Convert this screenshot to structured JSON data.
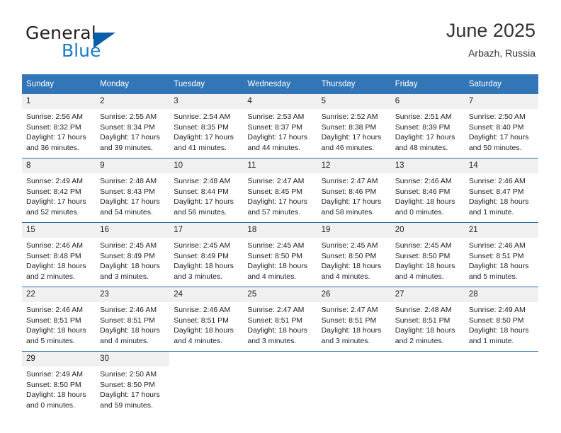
{
  "brand": {
    "name_part1": "General",
    "name_part2": "Blue",
    "accent_color": "#1a7bc4",
    "triangle_color": "#0b5ea8"
  },
  "header": {
    "title": "June 2025",
    "location": "Arbazh, Russia"
  },
  "calendar": {
    "header_bg": "#3276b8",
    "row_divider_color": "#2e6da4",
    "daynum_bg": "#f0f0f0",
    "weekdays": [
      "Sunday",
      "Monday",
      "Tuesday",
      "Wednesday",
      "Thursday",
      "Friday",
      "Saturday"
    ],
    "weeks": [
      [
        {
          "day": "1",
          "sunrise": "Sunrise: 2:56 AM",
          "sunset": "Sunset: 8:32 PM",
          "daylight1": "Daylight: 17 hours",
          "daylight2": "and 36 minutes."
        },
        {
          "day": "2",
          "sunrise": "Sunrise: 2:55 AM",
          "sunset": "Sunset: 8:34 PM",
          "daylight1": "Daylight: 17 hours",
          "daylight2": "and 39 minutes."
        },
        {
          "day": "3",
          "sunrise": "Sunrise: 2:54 AM",
          "sunset": "Sunset: 8:35 PM",
          "daylight1": "Daylight: 17 hours",
          "daylight2": "and 41 minutes."
        },
        {
          "day": "4",
          "sunrise": "Sunrise: 2:53 AM",
          "sunset": "Sunset: 8:37 PM",
          "daylight1": "Daylight: 17 hours",
          "daylight2": "and 44 minutes."
        },
        {
          "day": "5",
          "sunrise": "Sunrise: 2:52 AM",
          "sunset": "Sunset: 8:38 PM",
          "daylight1": "Daylight: 17 hours",
          "daylight2": "and 46 minutes."
        },
        {
          "day": "6",
          "sunrise": "Sunrise: 2:51 AM",
          "sunset": "Sunset: 8:39 PM",
          "daylight1": "Daylight: 17 hours",
          "daylight2": "and 48 minutes."
        },
        {
          "day": "7",
          "sunrise": "Sunrise: 2:50 AM",
          "sunset": "Sunset: 8:40 PM",
          "daylight1": "Daylight: 17 hours",
          "daylight2": "and 50 minutes."
        }
      ],
      [
        {
          "day": "8",
          "sunrise": "Sunrise: 2:49 AM",
          "sunset": "Sunset: 8:42 PM",
          "daylight1": "Daylight: 17 hours",
          "daylight2": "and 52 minutes."
        },
        {
          "day": "9",
          "sunrise": "Sunrise: 2:48 AM",
          "sunset": "Sunset: 8:43 PM",
          "daylight1": "Daylight: 17 hours",
          "daylight2": "and 54 minutes."
        },
        {
          "day": "10",
          "sunrise": "Sunrise: 2:48 AM",
          "sunset": "Sunset: 8:44 PM",
          "daylight1": "Daylight: 17 hours",
          "daylight2": "and 56 minutes."
        },
        {
          "day": "11",
          "sunrise": "Sunrise: 2:47 AM",
          "sunset": "Sunset: 8:45 PM",
          "daylight1": "Daylight: 17 hours",
          "daylight2": "and 57 minutes."
        },
        {
          "day": "12",
          "sunrise": "Sunrise: 2:47 AM",
          "sunset": "Sunset: 8:46 PM",
          "daylight1": "Daylight: 17 hours",
          "daylight2": "and 58 minutes."
        },
        {
          "day": "13",
          "sunrise": "Sunrise: 2:46 AM",
          "sunset": "Sunset: 8:46 PM",
          "daylight1": "Daylight: 18 hours",
          "daylight2": "and 0 minutes."
        },
        {
          "day": "14",
          "sunrise": "Sunrise: 2:46 AM",
          "sunset": "Sunset: 8:47 PM",
          "daylight1": "Daylight: 18 hours",
          "daylight2": "and 1 minute."
        }
      ],
      [
        {
          "day": "15",
          "sunrise": "Sunrise: 2:46 AM",
          "sunset": "Sunset: 8:48 PM",
          "daylight1": "Daylight: 18 hours",
          "daylight2": "and 2 minutes."
        },
        {
          "day": "16",
          "sunrise": "Sunrise: 2:45 AM",
          "sunset": "Sunset: 8:49 PM",
          "daylight1": "Daylight: 18 hours",
          "daylight2": "and 3 minutes."
        },
        {
          "day": "17",
          "sunrise": "Sunrise: 2:45 AM",
          "sunset": "Sunset: 8:49 PM",
          "daylight1": "Daylight: 18 hours",
          "daylight2": "and 3 minutes."
        },
        {
          "day": "18",
          "sunrise": "Sunrise: 2:45 AM",
          "sunset": "Sunset: 8:50 PM",
          "daylight1": "Daylight: 18 hours",
          "daylight2": "and 4 minutes."
        },
        {
          "day": "19",
          "sunrise": "Sunrise: 2:45 AM",
          "sunset": "Sunset: 8:50 PM",
          "daylight1": "Daylight: 18 hours",
          "daylight2": "and 4 minutes."
        },
        {
          "day": "20",
          "sunrise": "Sunrise: 2:45 AM",
          "sunset": "Sunset: 8:50 PM",
          "daylight1": "Daylight: 18 hours",
          "daylight2": "and 4 minutes."
        },
        {
          "day": "21",
          "sunrise": "Sunrise: 2:46 AM",
          "sunset": "Sunset: 8:51 PM",
          "daylight1": "Daylight: 18 hours",
          "daylight2": "and 5 minutes."
        }
      ],
      [
        {
          "day": "22",
          "sunrise": "Sunrise: 2:46 AM",
          "sunset": "Sunset: 8:51 PM",
          "daylight1": "Daylight: 18 hours",
          "daylight2": "and 5 minutes."
        },
        {
          "day": "23",
          "sunrise": "Sunrise: 2:46 AM",
          "sunset": "Sunset: 8:51 PM",
          "daylight1": "Daylight: 18 hours",
          "daylight2": "and 4 minutes."
        },
        {
          "day": "24",
          "sunrise": "Sunrise: 2:46 AM",
          "sunset": "Sunset: 8:51 PM",
          "daylight1": "Daylight: 18 hours",
          "daylight2": "and 4 minutes."
        },
        {
          "day": "25",
          "sunrise": "Sunrise: 2:47 AM",
          "sunset": "Sunset: 8:51 PM",
          "daylight1": "Daylight: 18 hours",
          "daylight2": "and 3 minutes."
        },
        {
          "day": "26",
          "sunrise": "Sunrise: 2:47 AM",
          "sunset": "Sunset: 8:51 PM",
          "daylight1": "Daylight: 18 hours",
          "daylight2": "and 3 minutes."
        },
        {
          "day": "27",
          "sunrise": "Sunrise: 2:48 AM",
          "sunset": "Sunset: 8:51 PM",
          "daylight1": "Daylight: 18 hours",
          "daylight2": "and 2 minutes."
        },
        {
          "day": "28",
          "sunrise": "Sunrise: 2:49 AM",
          "sunset": "Sunset: 8:50 PM",
          "daylight1": "Daylight: 18 hours",
          "daylight2": "and 1 minute."
        }
      ],
      [
        {
          "day": "29",
          "sunrise": "Sunrise: 2:49 AM",
          "sunset": "Sunset: 8:50 PM",
          "daylight1": "Daylight: 18 hours",
          "daylight2": "and 0 minutes."
        },
        {
          "day": "30",
          "sunrise": "Sunrise: 2:50 AM",
          "sunset": "Sunset: 8:50 PM",
          "daylight1": "Daylight: 17 hours",
          "daylight2": "and 59 minutes."
        },
        {
          "day": "",
          "sunrise": "",
          "sunset": "",
          "daylight1": "",
          "daylight2": ""
        },
        {
          "day": "",
          "sunrise": "",
          "sunset": "",
          "daylight1": "",
          "daylight2": ""
        },
        {
          "day": "",
          "sunrise": "",
          "sunset": "",
          "daylight1": "",
          "daylight2": ""
        },
        {
          "day": "",
          "sunrise": "",
          "sunset": "",
          "daylight1": "",
          "daylight2": ""
        },
        {
          "day": "",
          "sunrise": "",
          "sunset": "",
          "daylight1": "",
          "daylight2": ""
        }
      ]
    ]
  }
}
